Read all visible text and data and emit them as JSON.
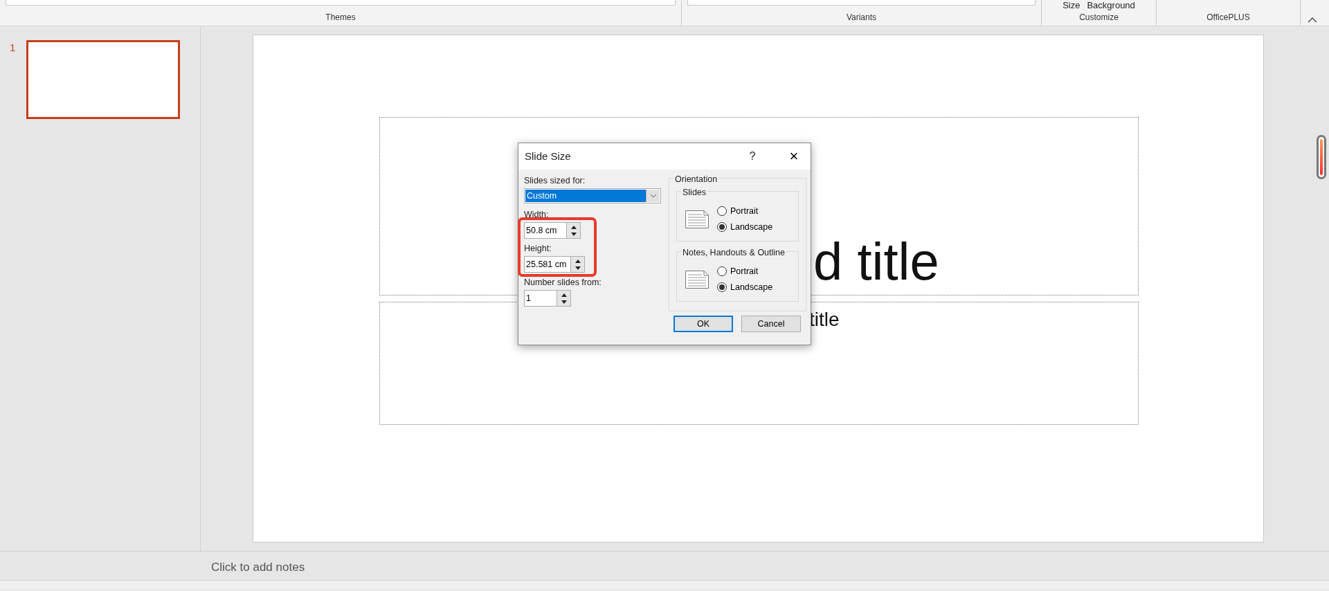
{
  "ribbon": {
    "groups": [
      {
        "kind": "gallery",
        "label": "Themes"
      },
      {
        "kind": "gallery",
        "label": "Variants"
      },
      {
        "kind": "buttons",
        "label": "Customize",
        "buttons": [
          "Size",
          "Background"
        ]
      },
      {
        "kind": "empty",
        "label": "OfficePLUS"
      }
    ]
  },
  "thumbnails": [
    {
      "number": "1",
      "selected": true
    }
  ],
  "slide": {
    "title": "d title",
    "subtitle": "title"
  },
  "notes": {
    "placeholder": "Click to add notes"
  },
  "dialog": {
    "title": "Slide Size",
    "help": "?",
    "close": "×",
    "sized_for_label": "Slides sized for:",
    "sized_for_value": "Custom",
    "width_label": "Width:",
    "width_value": "50.8 cm",
    "height_label": "Height:",
    "height_value": "25.581 cm",
    "number_label": "Number slides from:",
    "number_value": "1",
    "orientation": {
      "legend": "Orientation",
      "groups": [
        {
          "legend": "Slides",
          "options": [
            {
              "label": "Portrait",
              "selected": false
            },
            {
              "label": "Landscape",
              "selected": true
            }
          ]
        },
        {
          "legend": "Notes, Handouts & Outline",
          "options": [
            {
              "label": "Portrait",
              "selected": false
            },
            {
              "label": "Landscape",
              "selected": true
            }
          ]
        }
      ]
    },
    "buttons": [
      {
        "label": "OK",
        "default": true
      },
      {
        "label": "Cancel",
        "default": false
      }
    ],
    "highlight": true
  }
}
